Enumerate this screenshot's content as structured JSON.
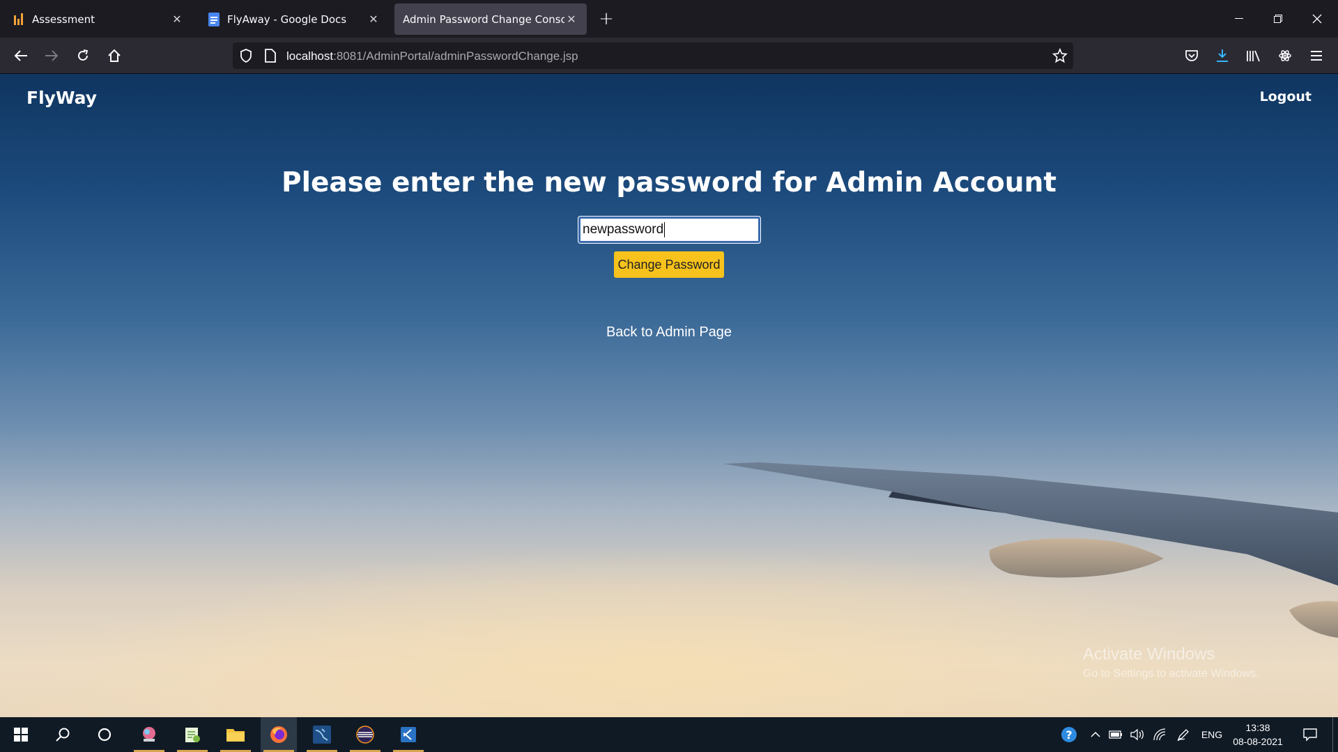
{
  "browser": {
    "tabs": [
      {
        "title": "Assessment",
        "icon": "bars-icon",
        "active": false
      },
      {
        "title": "FlyAway - Google Docs",
        "icon": "google-docs-icon",
        "active": false
      },
      {
        "title": "Admin Password Change Console",
        "icon": "none",
        "active": true
      }
    ],
    "url_host": "localhost",
    "url_rest": ":8081/AdminPortal/adminPasswordChange.jsp"
  },
  "page": {
    "brand": "FlyWay",
    "logout_label": "Logout",
    "heading": "Please enter the new password for Admin Account",
    "password_value": "newpassword",
    "change_button_label": "Change Password",
    "back_link_label": "Back to Admin Page"
  },
  "watermark": {
    "title": "Activate Windows",
    "subtitle": "Go to Settings to activate Windows."
  },
  "taskbar": {
    "language": "ENG",
    "time": "13:38",
    "date": "08-08-2021"
  },
  "colors": {
    "button_accent": "#f7c21c",
    "input_focus_border": "#3c6bb0",
    "tabbar_bg": "#1c1b22",
    "navbar_bg": "#2b2a33"
  }
}
